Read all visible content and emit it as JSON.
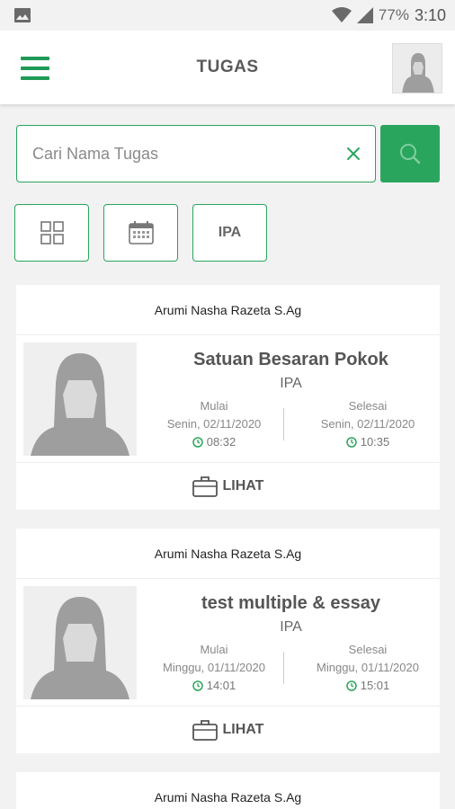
{
  "status_bar": {
    "battery": "77%",
    "time": "3:10"
  },
  "header": {
    "title": "TUGAS"
  },
  "search": {
    "placeholder": "Cari Nama Tugas"
  },
  "filters": [
    {
      "icon": "grid-icon",
      "label": ""
    },
    {
      "icon": "calendar-icon",
      "label": ""
    },
    {
      "icon": "",
      "label": "IPA"
    }
  ],
  "tasks": [
    {
      "author": "Arumi Nasha Razeta S.Ag",
      "title": "Satuan Besaran Pokok",
      "subject": "IPA",
      "start_label": "Mulai",
      "start_date": "Senin, 02/11/2020",
      "start_time": "08:32",
      "end_label": "Selesai",
      "end_date": "Senin, 02/11/2020",
      "end_time": "10:35",
      "action": "LIHAT"
    },
    {
      "author": "Arumi Nasha Razeta S.Ag",
      "title": "test multiple & essay",
      "subject": "IPA",
      "start_label": "Mulai",
      "start_date": "Minggu, 01/11/2020",
      "start_time": "14:01",
      "end_label": "Selesai",
      "end_date": "Minggu, 01/11/2020",
      "end_time": "15:01",
      "action": "LIHAT"
    },
    {
      "author": "Arumi Nasha Razeta S.Ag"
    }
  ],
  "colors": {
    "accent": "#2aa55e",
    "background": "#f2f2f2"
  }
}
